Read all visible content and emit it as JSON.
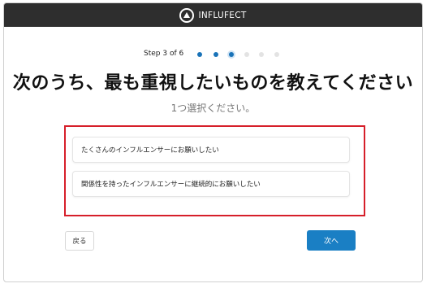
{
  "header": {
    "brand": "INFLUFECT",
    "logo_icon": "triangle-in-circle-icon"
  },
  "stepper": {
    "label": "Step 3 of 6",
    "total": 6,
    "current": 3
  },
  "question": {
    "title": "次のうち、最も重視したいものを教えてください",
    "subtitle": "1つ選択ください。"
  },
  "options": [
    {
      "label": "たくさんのインフルエンサーにお願いしたい"
    },
    {
      "label": "関係性を持ったインフルエンサーに継続的にお願いしたい"
    }
  ],
  "buttons": {
    "back": "戻る",
    "next": "次へ"
  },
  "colors": {
    "accent": "#1a7fc4",
    "highlight_border": "#d61f2a",
    "header_bg": "#2e2e2e"
  }
}
